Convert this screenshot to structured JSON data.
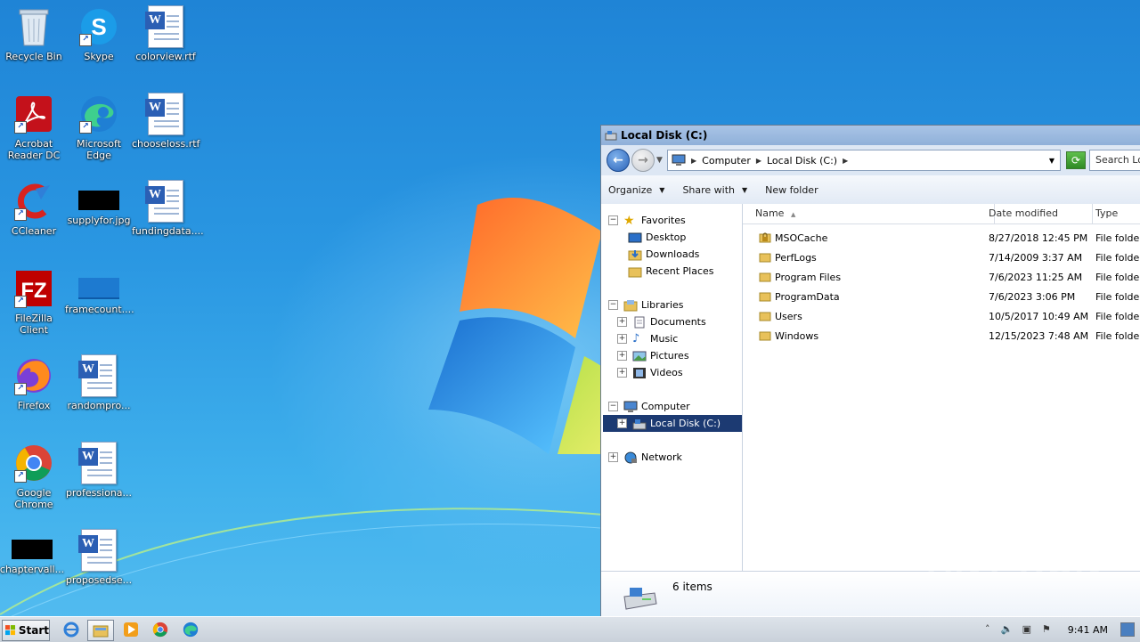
{
  "desktop": {
    "icons": [
      {
        "label": "Recycle Bin"
      },
      {
        "label": "Skype"
      },
      {
        "label": "colorview.rtf"
      },
      {
        "label": "Acrobat Reader DC"
      },
      {
        "label": "Microsoft Edge"
      },
      {
        "label": "chooseloss.rtf"
      },
      {
        "label": "CCleaner"
      },
      {
        "label": "supplyfor.jpg"
      },
      {
        "label": "fundingdata...."
      },
      {
        "label": "FileZilla Client"
      },
      {
        "label": "framecount...."
      },
      {
        "label": "Firefox"
      },
      {
        "label": "randompro..."
      },
      {
        "label": "Google Chrome"
      },
      {
        "label": "professiona..."
      },
      {
        "label": "chaptervall..."
      },
      {
        "label": "proposedse..."
      }
    ]
  },
  "window": {
    "title": "Local Disk (C:)",
    "address": {
      "crumbs": [
        "Computer",
        "Local Disk (C:)"
      ]
    },
    "search_placeholder": "Search Local Disk (C:)",
    "toolbar": {
      "organize": "Organize",
      "share_with": "Share with",
      "new_folder": "New folder"
    },
    "tree": {
      "favorites": "Favorites",
      "desktop": "Desktop",
      "downloads": "Downloads",
      "recent_places": "Recent Places",
      "libraries": "Libraries",
      "documents": "Documents",
      "music": "Music",
      "pictures": "Pictures",
      "videos": "Videos",
      "computer": "Computer",
      "local_disk": "Local Disk (C:)",
      "network": "Network"
    },
    "columns": {
      "name": "Name",
      "date_modified": "Date modified",
      "type": "Type"
    },
    "files": [
      {
        "name": "MSOCache",
        "date": "8/27/2018 12:45 PM",
        "type": "File folder",
        "locked": true
      },
      {
        "name": "PerfLogs",
        "date": "7/14/2009 3:37 AM",
        "type": "File folder",
        "locked": false
      },
      {
        "name": "Program Files",
        "date": "7/6/2023 11:25 AM",
        "type": "File folder",
        "locked": false
      },
      {
        "name": "ProgramData",
        "date": "7/6/2023 3:06 PM",
        "type": "File folder",
        "locked": false
      },
      {
        "name": "Users",
        "date": "10/5/2017 10:49 AM",
        "type": "File folder",
        "locked": false
      },
      {
        "name": "Windows",
        "date": "12/15/2023 7:48 AM",
        "type": "File folder",
        "locked": false
      }
    ],
    "details": {
      "count": "6 items"
    }
  },
  "watermark": "ANY RUN",
  "taskbar": {
    "start_label": "Start",
    "clock": "9:41 AM"
  }
}
